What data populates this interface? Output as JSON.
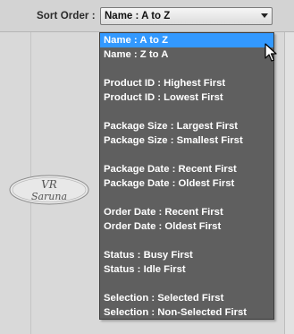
{
  "sort": {
    "label": "Sort Order :",
    "selected_value": "Name : A to Z"
  },
  "logo": {
    "text_line1": "VR",
    "text_line2": "Saruna"
  },
  "dropdown": {
    "options": [
      {
        "label": "Name : A to Z",
        "selected": true
      },
      {
        "label": "Name : Z to A",
        "selected": false
      },
      {
        "label": "Product ID : Highest First",
        "selected": false
      },
      {
        "label": "Product ID : Lowest First",
        "selected": false
      },
      {
        "label": "Package Size : Largest First",
        "selected": false
      },
      {
        "label": "Package Size : Smallest First",
        "selected": false
      },
      {
        "label": "Package Date : Recent First",
        "selected": false
      },
      {
        "label": "Package Date : Oldest First",
        "selected": false
      },
      {
        "label": "Order Date : Recent First",
        "selected": false
      },
      {
        "label": "Order Date : Oldest First",
        "selected": false
      },
      {
        "label": "Status : Busy First",
        "selected": false
      },
      {
        "label": "Status : Idle First",
        "selected": false
      },
      {
        "label": "Selection : Selected First",
        "selected": false
      },
      {
        "label": "Selection : Non-Selected First",
        "selected": false
      }
    ]
  },
  "colors": {
    "menu_background": "#5f5f5f",
    "selection_highlight": "#3399ff",
    "option_text": "#ffffff"
  }
}
